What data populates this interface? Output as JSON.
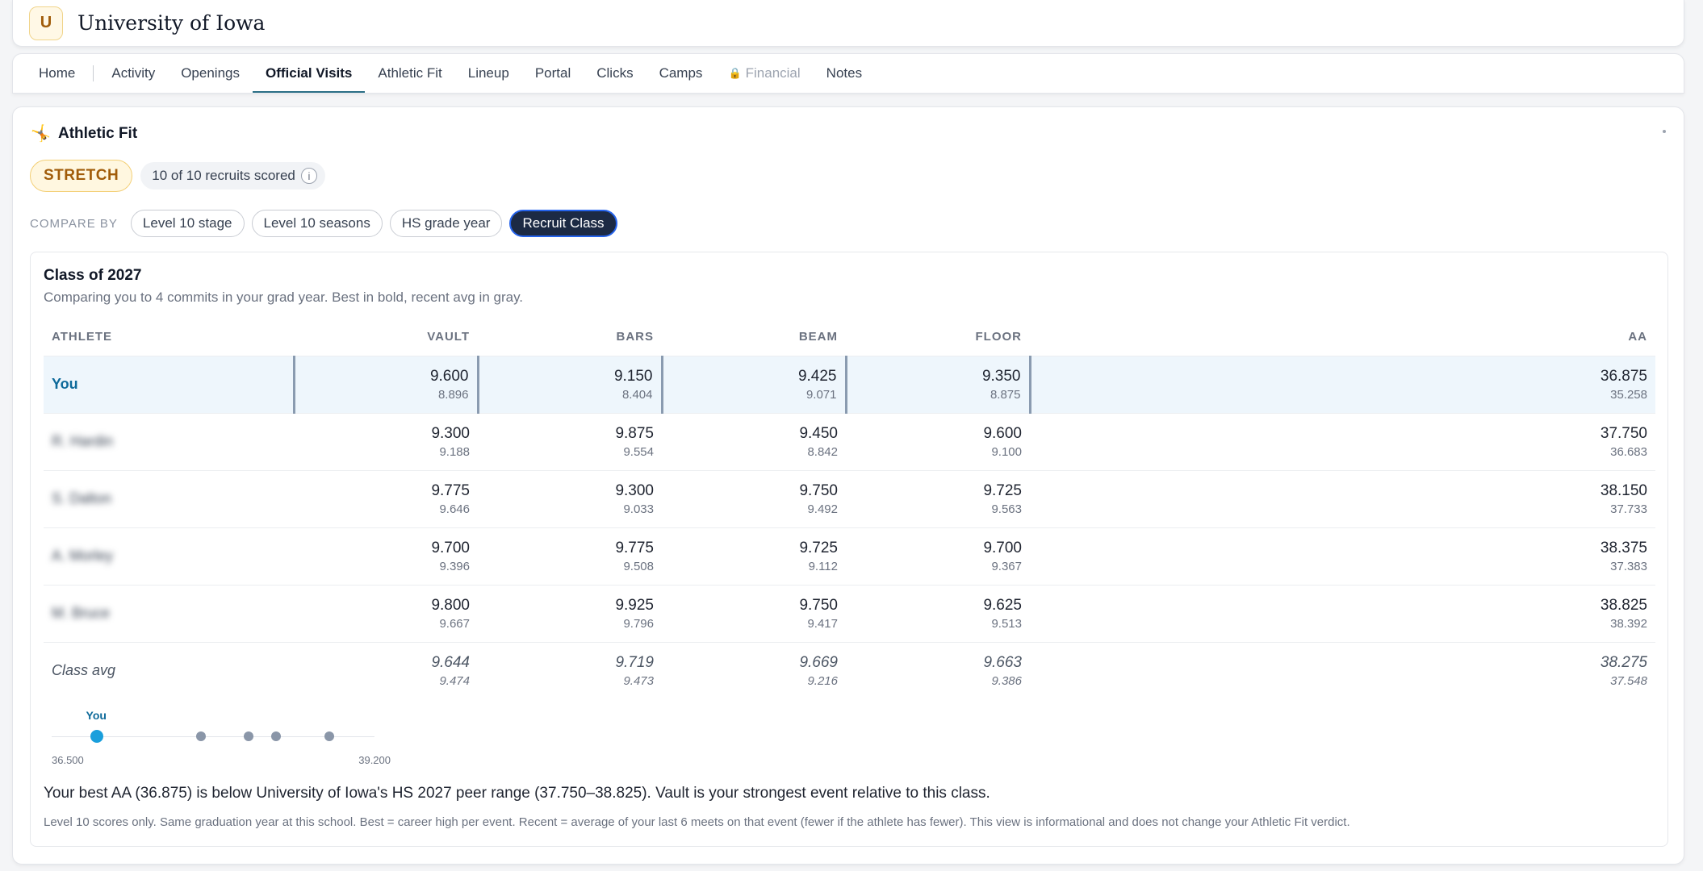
{
  "school": {
    "initial": "U",
    "name": "University of Iowa"
  },
  "nav": {
    "home": "Home",
    "tabs": [
      {
        "label": "Activity"
      },
      {
        "label": "Openings"
      },
      {
        "label": "Official Visits"
      },
      {
        "label": "Athletic Fit"
      },
      {
        "label": "Lineup"
      },
      {
        "label": "Portal"
      },
      {
        "label": "Clicks"
      },
      {
        "label": "Camps"
      },
      {
        "label": "Financial"
      },
      {
        "label": "Notes"
      }
    ],
    "active_tab": "Official Visits",
    "locked_tab": "Financial"
  },
  "section": {
    "title": "Athletic Fit",
    "icon": "gymnast-icon"
  },
  "status": {
    "verdict": "STRETCH",
    "scored": "10 of 10 recruits scored",
    "info_glyph": "i"
  },
  "compare": {
    "label": "COMPARE BY",
    "options": [
      "Level 10 stage",
      "Level 10 seasons",
      "HS grade year",
      "Recruit Class"
    ],
    "selected": "Recruit Class"
  },
  "class_card": {
    "title": "Class of 2027",
    "subtitle": "Comparing you to 4 commits in your grad year. Best in bold, recent avg in gray."
  },
  "table": {
    "headers": [
      "ATHLETE",
      "VAULT",
      "BARS",
      "BEAM",
      "FLOOR",
      "AA"
    ],
    "rows": [
      {
        "name": "You",
        "type": "you",
        "cells": [
          [
            "9.600",
            "8.896"
          ],
          [
            "9.150",
            "8.404"
          ],
          [
            "9.425",
            "9.071"
          ],
          [
            "9.350",
            "8.875"
          ],
          [
            "36.875",
            "35.258"
          ]
        ]
      },
      {
        "name": "R. Hardin",
        "type": "blurred",
        "cells": [
          [
            "9.300",
            "9.188"
          ],
          [
            "9.875",
            "9.554"
          ],
          [
            "9.450",
            "8.842"
          ],
          [
            "9.600",
            "9.100"
          ],
          [
            "37.750",
            "36.683"
          ]
        ]
      },
      {
        "name": "S. Dalton",
        "type": "blurred",
        "cells": [
          [
            "9.775",
            "9.646"
          ],
          [
            "9.300",
            "9.033"
          ],
          [
            "9.750",
            "9.492"
          ],
          [
            "9.725",
            "9.563"
          ],
          [
            "38.150",
            "37.733"
          ]
        ]
      },
      {
        "name": "A. Morley",
        "type": "blurred",
        "cells": [
          [
            "9.700",
            "9.396"
          ],
          [
            "9.775",
            "9.508"
          ],
          [
            "9.725",
            "9.112"
          ],
          [
            "9.700",
            "9.367"
          ],
          [
            "38.375",
            "37.383"
          ]
        ]
      },
      {
        "name": "M. Bruce",
        "type": "blurred",
        "cells": [
          [
            "9.800",
            "9.667"
          ],
          [
            "9.925",
            "9.796"
          ],
          [
            "9.750",
            "9.417"
          ],
          [
            "9.625",
            "9.513"
          ],
          [
            "38.825",
            "38.392"
          ]
        ]
      },
      {
        "name": "Class avg",
        "type": "avg",
        "cells": [
          [
            "9.644",
            "9.474"
          ],
          [
            "9.719",
            "9.473"
          ],
          [
            "9.669",
            "9.216"
          ],
          [
            "9.663",
            "9.386"
          ],
          [
            "38.275",
            "37.548"
          ]
        ]
      }
    ]
  },
  "aa_strip": {
    "you_label": "You",
    "min": 36.5,
    "max": 39.2,
    "min_label": "36.500",
    "max_label": "39.200",
    "you_value": 36.875,
    "peer_values": [
      37.75,
      38.15,
      38.375,
      38.825
    ]
  },
  "summary": "Your best AA (36.875) is below University of Iowa's HS 2027 peer range (37.750–38.825). Vault is your strongest event relative to this class.",
  "footnote": "Level 10 scores only. Same graduation year at this school. Best = career high per event. Recent = average of your last 6 meets on that event (fewer if the athlete has fewer). This view is informational and does not change your Athletic Fit verdict.",
  "colors": {
    "accent": "#1a9fdc",
    "you_name": "#0e6a9a",
    "stretch": "#a15c0a",
    "active_pill": "#1c2a44"
  }
}
